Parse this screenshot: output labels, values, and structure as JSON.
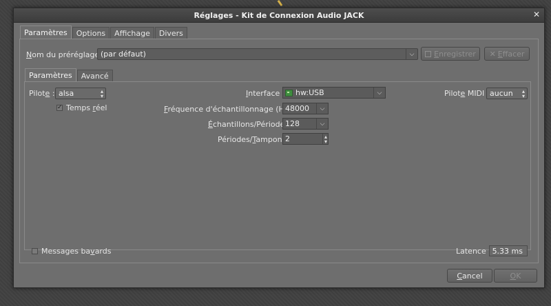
{
  "window": {
    "title": "Réglages - Kit de Connexion Audio JACK",
    "close_glyph": "✕"
  },
  "outer_tabs": [
    {
      "label": "Paramètres",
      "active": true
    },
    {
      "label": "Options",
      "active": false
    },
    {
      "label": "Affichage",
      "active": false
    },
    {
      "label": "Divers",
      "active": false
    }
  ],
  "preset": {
    "label_prefix": "N",
    "label_rest": "om du préréglage :",
    "value": "(par défaut)",
    "save_prefix": "E",
    "save_rest": "nregistrer",
    "delete_prefix": "E",
    "delete_rest": "ffacer",
    "delete_icon": "✕"
  },
  "inner_tabs": [
    {
      "label": "Paramètres",
      "active": true
    },
    {
      "label": "Avancé",
      "active": false
    }
  ],
  "params": {
    "driver_label_a": "Pilot",
    "driver_label_u": "e",
    "driver_label_b": " :",
    "driver_value": "alsa",
    "realtime_label_a": "Temps ",
    "realtime_label_u": "r",
    "realtime_label_b": "éel",
    "realtime_checked": true,
    "interface_label_a": "",
    "interface_label_u": "I",
    "interface_label_b": "nterface :",
    "interface_value": "hw:USB",
    "midi_label_a": "Pilot",
    "midi_label_u": "e",
    "midi_label_b": " MIDI :",
    "midi_value": "aucun",
    "samplerate_label_a": "",
    "samplerate_label_u": "F",
    "samplerate_label_b": "réquence d'échantillonnage (Hz) :",
    "samplerate_value": "48000",
    "frames_label_a": "",
    "frames_label_u": "É",
    "frames_label_b": "chantillons/Période :",
    "frames_value": "128",
    "periods_label_a": "Périodes/",
    "periods_label_u": "T",
    "periods_label_b": "ampon :",
    "periods_value": "2",
    "verbose_label_a": "Messages ba",
    "verbose_label_u": "v",
    "verbose_label_b": "ards",
    "verbose_checked": false,
    "latency_label": "Latence :",
    "latency_value": "5.33 ms"
  },
  "footer": {
    "cancel_prefix": "C",
    "cancel_rest": "ancel",
    "ok_prefix": "O",
    "ok_rest": "K"
  }
}
